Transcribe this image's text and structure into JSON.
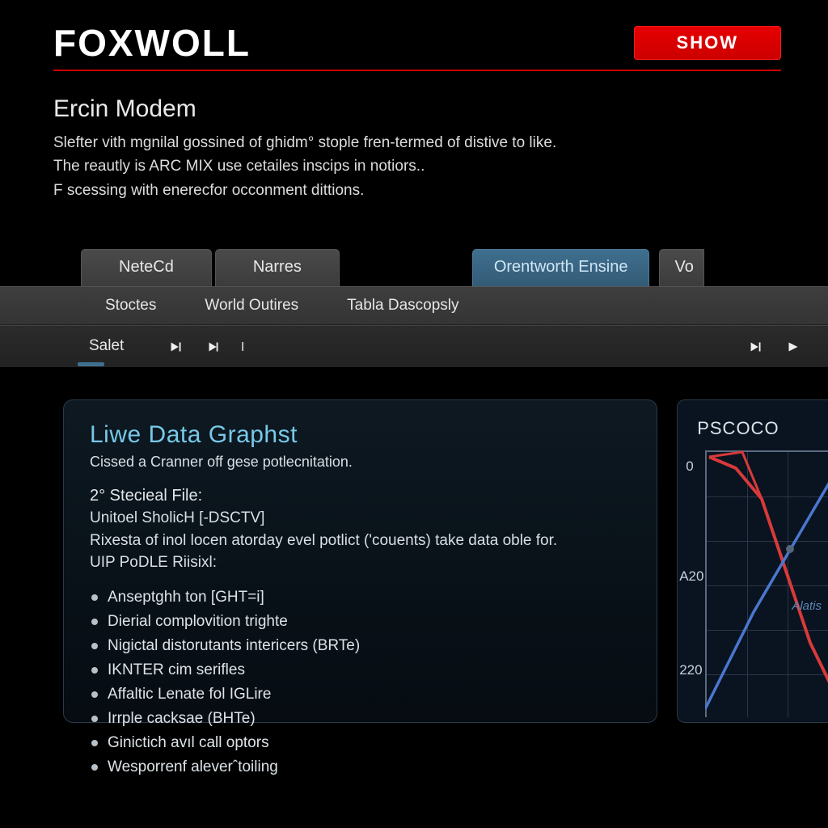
{
  "header": {
    "brand": "FOXWOLL",
    "show_label": "SHOW"
  },
  "intro": {
    "title": "Ercin Modem",
    "line1": "Slefter vith mgnilal gossined of ghidm° stople fren-termed of distive to like.",
    "line2": "The reautly is ARC MIX use cetailes inscips in notiors..",
    "line3": "F scessing with enerecfor occonment dittions."
  },
  "tabs": {
    "row1": [
      "NeteCd",
      "Narres",
      "Orentworth Ensine",
      "Vo"
    ],
    "row2": [
      "Stoctes",
      "World Outires",
      "Tabla Dascopsly"
    ],
    "salet": "Salet"
  },
  "panel": {
    "title": "Liwe Data Graphst",
    "subtitle": "Cissed a Cranner off gese potlecnitation.",
    "section": "2° Stecieal File:",
    "l1": "Unitoel SholicH [-DSCTV]",
    "l2": "Rixesta of inol locen atorday evel potlict ('couents) take data oble for.",
    "l3": "UIP PoDLE Riisixl:",
    "bullets": [
      "Anseptghh ton [GHT=i]",
      "Dierial complovition trighte",
      "Nigictal distorutants intericers (BRTe)",
      "IKNTER cim serifles",
      "Affaltic Lenate fol IGLire",
      "Irrple cacksae (BHTe)",
      "Ginictich avıl call optors",
      "Wesporrenf aleverˆtoiling"
    ]
  },
  "chart": {
    "title": "PSCOCO",
    "ylabel_top": "0",
    "ylabel_mid": "A20",
    "ylabel_bot": "220",
    "annot": "Alatis"
  },
  "chart_data": {
    "type": "line",
    "title": "PSCOCO",
    "xlabel": "",
    "ylabel": "",
    "ylim": [
      0,
      220
    ],
    "y_ticks": [
      0,
      120,
      220
    ],
    "series": [
      {
        "name": "red",
        "color": "#d83a3a",
        "x": [
          0,
          30,
          60,
          100
        ],
        "values": [
          0,
          40,
          150,
          220
        ]
      },
      {
        "name": "blue",
        "color": "#4a78d0",
        "x": [
          0,
          40,
          70,
          100
        ],
        "values": [
          220,
          120,
          50,
          0
        ]
      }
    ],
    "annotations": [
      {
        "text": "Alatis",
        "x": 82,
        "y": 130
      }
    ]
  }
}
